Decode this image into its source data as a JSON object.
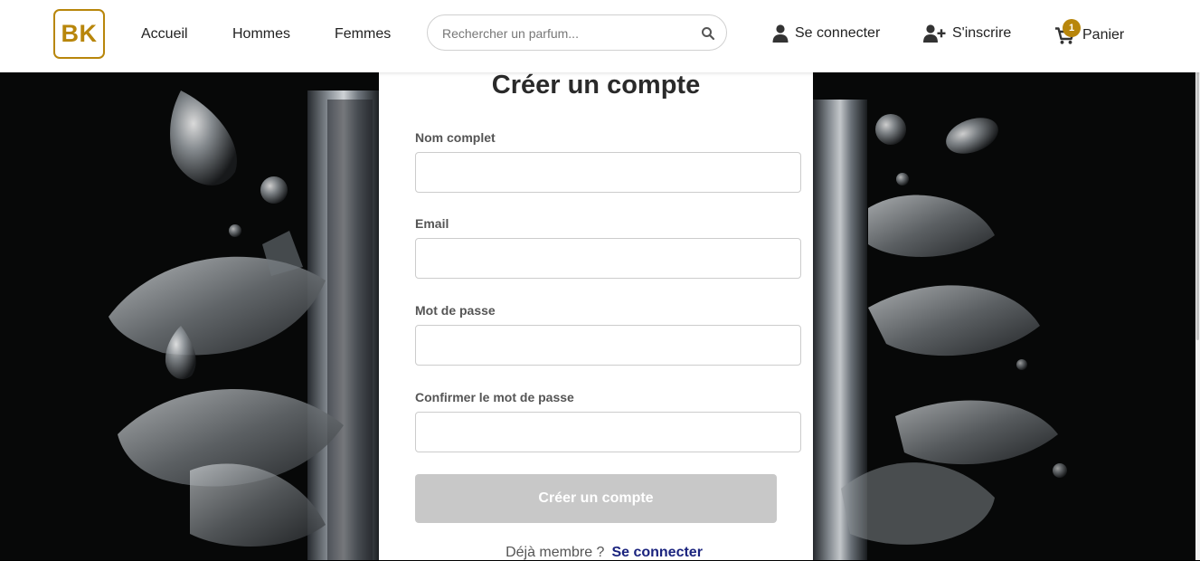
{
  "header": {
    "logo": "BK",
    "nav": [
      {
        "label": "Accueil"
      },
      {
        "label": "Hommes"
      },
      {
        "label": "Femmes"
      }
    ],
    "search": {
      "placeholder": "Rechercher un parfum...",
      "icon": "search-icon"
    },
    "login_label": "Se connecter",
    "register_label": "S'inscrire",
    "cart_label": "Panier",
    "cart_count": "1"
  },
  "form": {
    "title": "Créer un compte",
    "fields": [
      {
        "label": "Nom complet",
        "value": ""
      },
      {
        "label": "Email",
        "value": ""
      },
      {
        "label": "Mot de passe",
        "value": ""
      },
      {
        "label": "Confirmer le mot de passe",
        "value": ""
      }
    ],
    "submit_label": "Créer un compte",
    "already_member": "Déjà membre ?",
    "login_link": "Se connecter"
  },
  "colors": {
    "accent": "#b8860b",
    "link": "#1a237e",
    "disabled_button": "#c8c8c8"
  }
}
